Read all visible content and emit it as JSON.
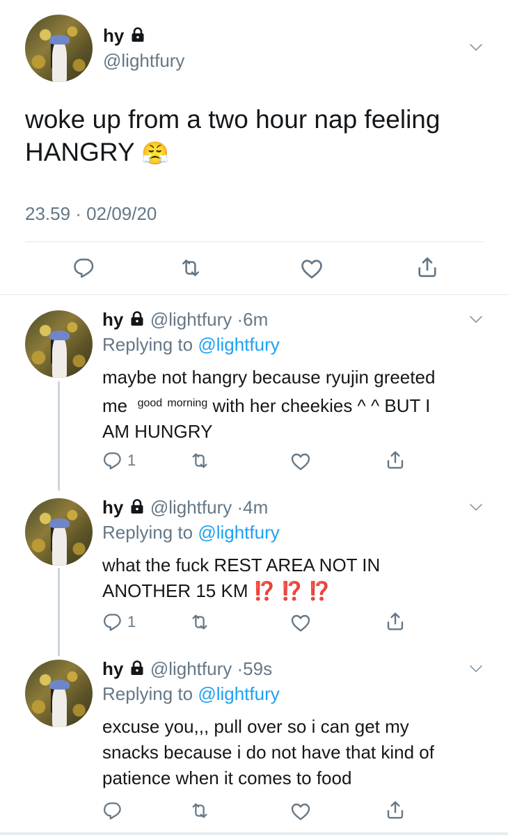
{
  "main_tweet": {
    "name": "hy",
    "handle": "@lightfury",
    "text_line1": "woke up from a two hour nap feeling",
    "text_line2": "HANGRY",
    "emoji": "😤",
    "timestamp": "23.59 · 02/09/20"
  },
  "replies": [
    {
      "name": "hy",
      "handle": "@lightfury",
      "time": "6m",
      "replying_prefix": "Replying to",
      "replying_to": "@lightfury",
      "text_a": "maybe not hangry because ryujin greeted",
      "text_b": "me",
      "text_small_1": "good",
      "text_small_2": "morning",
      "text_c": "with her cheekies ^ ^ BUT I",
      "text_d": "AM HUNGRY",
      "reply_count": "1"
    },
    {
      "name": "hy",
      "handle": "@lightfury",
      "time": "4m",
      "replying_prefix": "Replying to",
      "replying_to": "@lightfury",
      "text_a": "what the fuck REST AREA NOT IN",
      "text_b": "ANOTHER 15 KM",
      "marks": "⁉️ ⁉️ ⁉️",
      "reply_count": "1"
    },
    {
      "name": "hy",
      "handle": "@lightfury",
      "time": "59s",
      "replying_prefix": "Replying to",
      "replying_to": "@lightfury",
      "text_a": "excuse you,,, pull over so i can get my",
      "text_b": "snacks because i do not have that kind of",
      "text_c": "patience when it comes to food",
      "reply_count": ""
    }
  ],
  "colors": {
    "text": "#14171a",
    "muted": "#657786",
    "link": "#1da1f2",
    "divider": "#e1e8ed"
  }
}
